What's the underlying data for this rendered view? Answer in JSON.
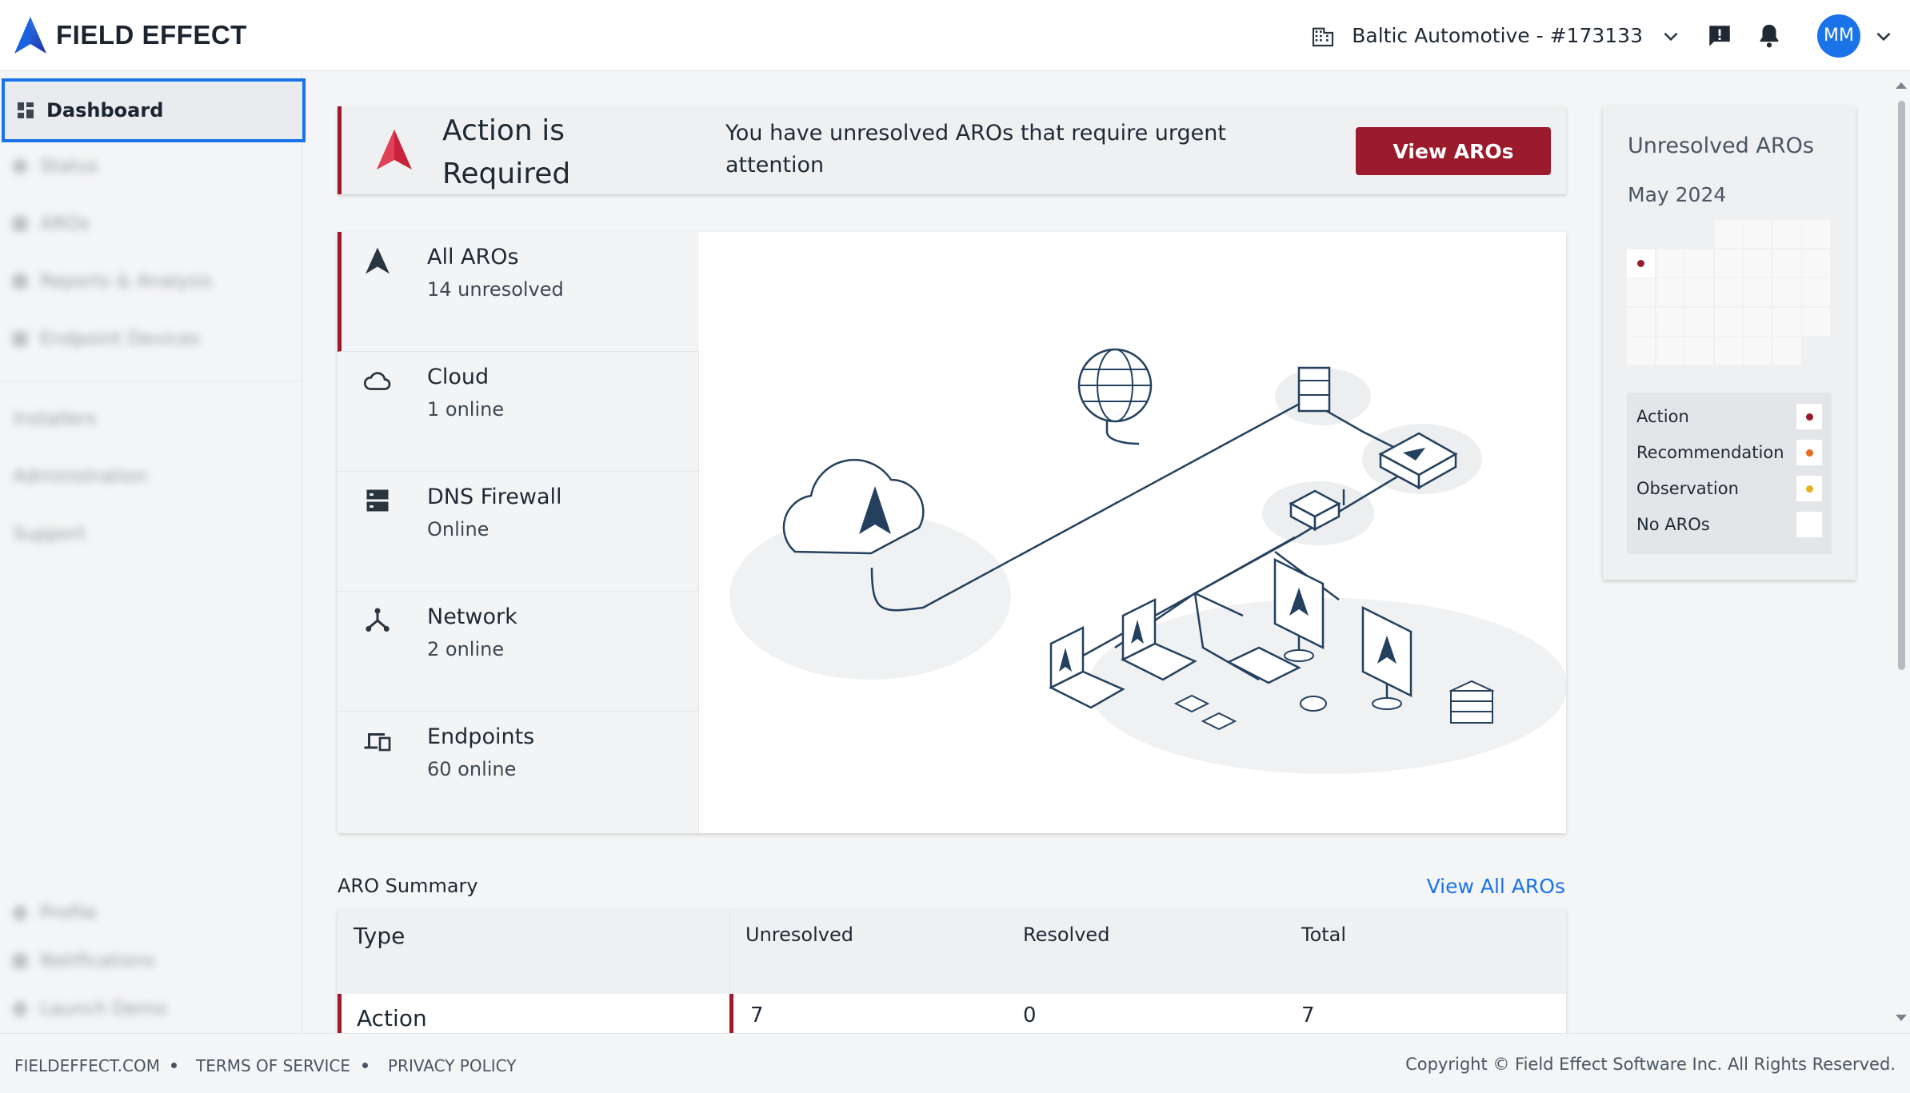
{
  "header": {
    "brand": "FIELD EFFECT",
    "org_label": "Baltic Automotive - #173133",
    "avatar_initials": "MM"
  },
  "sidebar": {
    "active_item": "Dashboard",
    "items": [
      "Status",
      "AROs",
      "Reports & Analysis",
      "Endpoint Devices"
    ],
    "secondary_items": [
      "Installers",
      "Administration",
      "Support"
    ],
    "bottom_items": [
      "Profile",
      "Notifications",
      "Launch Demo"
    ]
  },
  "alert": {
    "title": "Action is Required",
    "message": "You have unresolved AROs that require urgent attention",
    "button_label": "View AROs"
  },
  "categories": [
    {
      "name": "All AROs",
      "status": "14 unresolved",
      "icon": "aro-arrow-icon"
    },
    {
      "name": "Cloud",
      "status": "1 online",
      "icon": "cloud-icon"
    },
    {
      "name": "DNS Firewall",
      "status": "Online",
      "icon": "dns-firewall-icon"
    },
    {
      "name": "Network",
      "status": "2 online",
      "icon": "network-icon"
    },
    {
      "name": "Endpoints",
      "status": "60 online",
      "icon": "endpoints-icon"
    }
  ],
  "widget": {
    "title": "Unresolved AROs",
    "month": "May 2024",
    "legend": [
      {
        "label": "Action",
        "color": "#9b1b2c"
      },
      {
        "label": "Recommendation",
        "color": "#e86b1f"
      },
      {
        "label": "Observation",
        "color": "#e8b21f"
      },
      {
        "label": "No AROs",
        "color": ""
      }
    ]
  },
  "summary": {
    "title": "ARO Summary",
    "view_all_label": "View All AROs",
    "columns": [
      "Type",
      "Unresolved",
      "Resolved",
      "Total"
    ],
    "rows": [
      {
        "type": "Action",
        "unresolved": "7",
        "resolved": "0",
        "total": "7"
      }
    ]
  },
  "footer": {
    "links": [
      "FIELDEFFECT.COM",
      "TERMS OF SERVICE",
      "PRIVACY POLICY"
    ],
    "copyright": "Copyright © Field Effect Software Inc. All Rights Reserved."
  },
  "colors": {
    "accent": "#1a73e8",
    "action_red": "#9b1b2c"
  }
}
